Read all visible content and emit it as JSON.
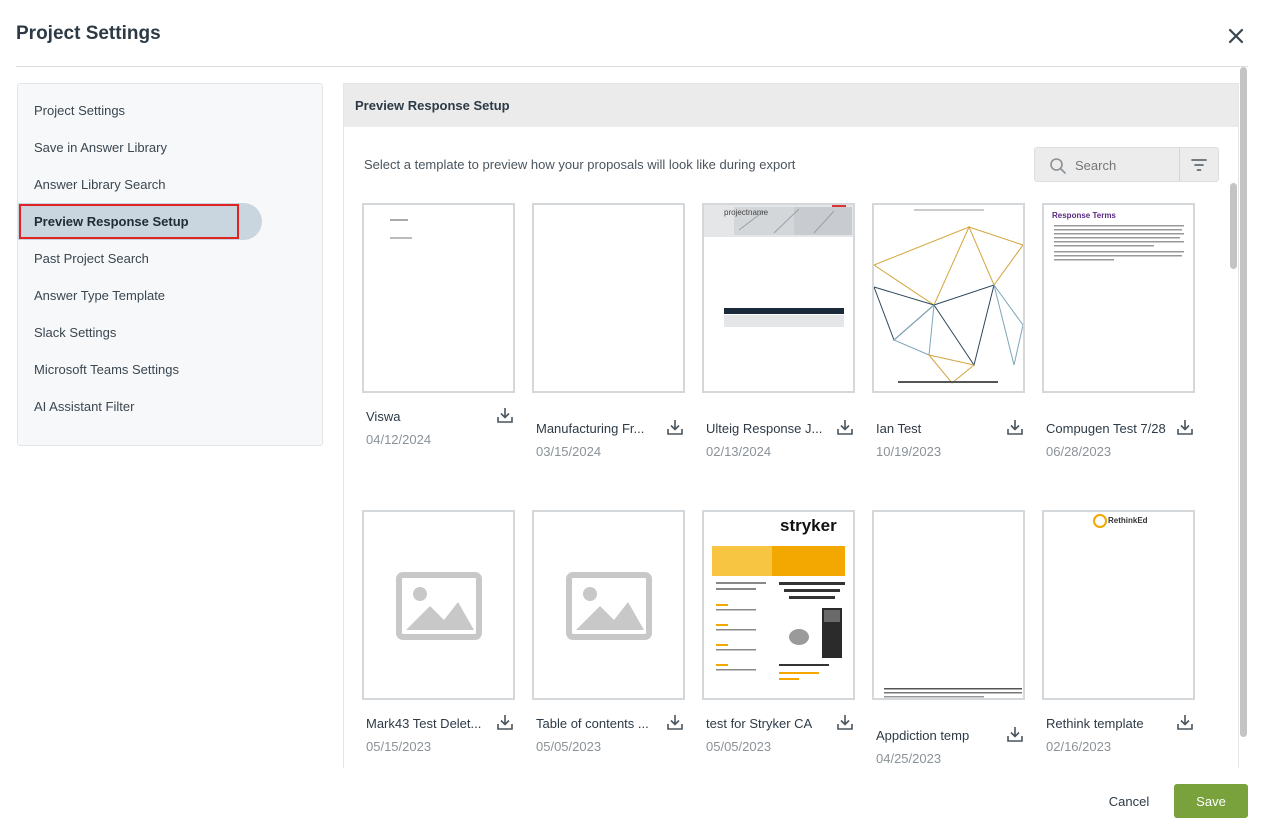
{
  "header": {
    "title": "Project Settings",
    "close_icon": "close-icon"
  },
  "sidebar": {
    "items": [
      {
        "label": "Project Settings"
      },
      {
        "label": "Save in Answer Library"
      },
      {
        "label": "Answer Library Search"
      },
      {
        "label": "Preview Response Setup",
        "active": true
      },
      {
        "label": "Past Project Search"
      },
      {
        "label": "Answer Type Template"
      },
      {
        "label": "Slack Settings"
      },
      {
        "label": "Microsoft Teams Settings"
      },
      {
        "label": "AI Assistant Filter"
      }
    ]
  },
  "panel": {
    "title": "Preview Response Setup",
    "intro": "Select a template to preview how your proposals will look like during export",
    "search": {
      "placeholder": "Search"
    }
  },
  "templates": [
    {
      "name": "Viswa",
      "date": "04/12/2024",
      "thumb": "doc-text"
    },
    {
      "name": "Manufacturing Fr...",
      "date": "03/15/2024",
      "thumb": "blank"
    },
    {
      "name": "Ulteig Response J...",
      "date": "02/13/2024",
      "thumb": "ulteig",
      "thumb_text": "projectname"
    },
    {
      "name": "Ian Test",
      "date": "10/19/2023",
      "thumb": "triangles"
    },
    {
      "name": "Compugen Test 7/28",
      "date": "06/28/2023",
      "thumb": "response-terms",
      "thumb_text": "Response Terms"
    },
    {
      "name": "Mark43 Test Delet...",
      "date": "05/15/2023",
      "thumb": "image-placeholder"
    },
    {
      "name": "Table of contents ...",
      "date": "05/05/2023",
      "thumb": "image-placeholder"
    },
    {
      "name": "test for Stryker CA",
      "date": "05/05/2023",
      "thumb": "stryker",
      "thumb_text": "stryker"
    },
    {
      "name": "Appdiction temp",
      "date": "04/25/2023",
      "thumb": "blank-footer"
    },
    {
      "name": "Rethink template",
      "date": "02/16/2023",
      "thumb": "rethinked",
      "thumb_text": "RethinkEd"
    }
  ],
  "footer": {
    "cancel_label": "Cancel",
    "save_label": "Save"
  },
  "colors": {
    "accent": "#7aa23c",
    "active_nav": "#c9d6df",
    "highlight_box": "#e02424"
  }
}
